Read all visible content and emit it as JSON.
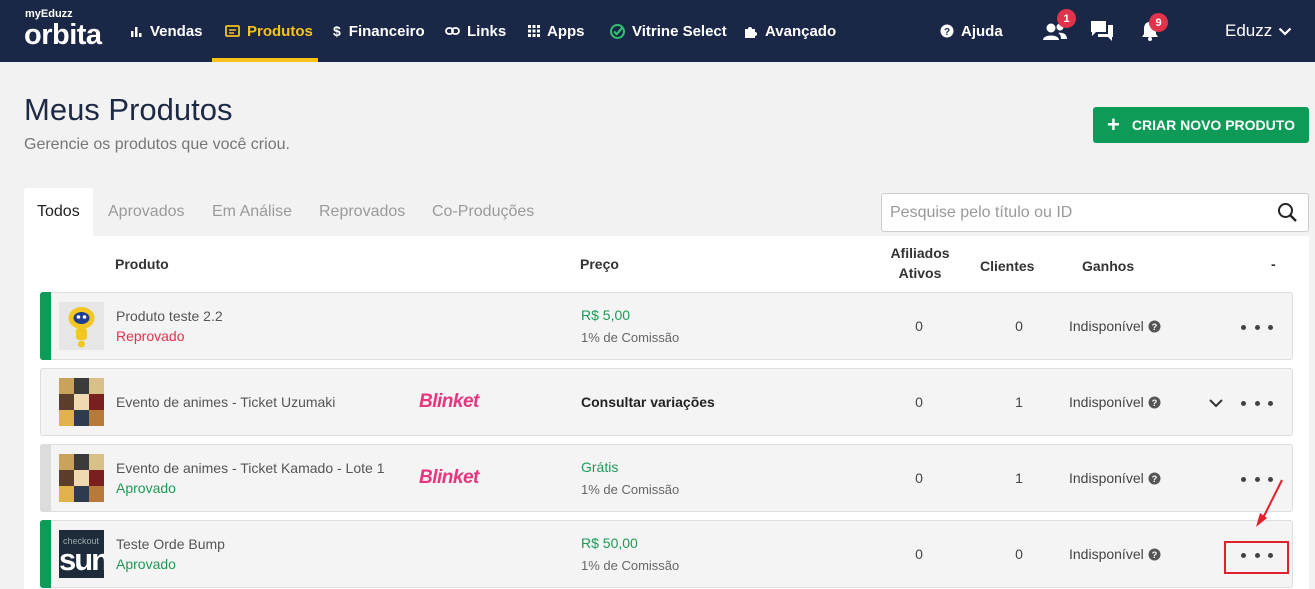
{
  "nav": {
    "logo_small": "myEduzz",
    "logo_big": "orbita",
    "items": [
      {
        "label": "Vendas",
        "icon": "bar-chart-icon"
      },
      {
        "label": "Produtos",
        "icon": "product-card-icon",
        "active": true
      },
      {
        "label": "Financeiro",
        "icon": "dollar-icon"
      },
      {
        "label": "Links",
        "icon": "link-icon"
      },
      {
        "label": "Apps",
        "icon": "grid-icon"
      },
      {
        "label": "Vitrine Select",
        "icon": "check-badge-icon"
      },
      {
        "label": "Avançado",
        "icon": "puzzle-icon"
      }
    ],
    "help_label": "Ajuda",
    "affiliates_badge": "1",
    "notifications_badge": "9",
    "user_label": "Eduzz",
    "active_color": "#f7c21a",
    "bg_color": "#1b2746"
  },
  "header": {
    "title": "Meus Produtos",
    "subtitle": "Gerencie os produtos que você criou.",
    "create_button": "CRIAR NOVO PRODUTO"
  },
  "tabs": [
    "Todos",
    "Aprovados",
    "Em Análise",
    "Reprovados",
    "Co-Produções"
  ],
  "search": {
    "placeholder": "Pesquise pelo título ou ID"
  },
  "table": {
    "headers": {
      "product": "Produto",
      "price": "Preço",
      "affiliates_line1": "Afiliados",
      "affiliates_line2": "Ativos",
      "clients": "Clientes",
      "earnings": "Ganhos",
      "actions": "-"
    },
    "rows": [
      {
        "name": "Produto teste 2.2",
        "status": "Reprovado",
        "status_color": "#e0334c",
        "bar_color": "#0e9b57",
        "price": "R$ 5,00",
        "commission": "1% de Comissão",
        "affiliates": "0",
        "clients": "0",
        "earnings": "Indisponível"
      },
      {
        "name": "Evento de animes - Ticket Uzumaki",
        "status": "",
        "brand": "Blinket",
        "variation": "Consultar variações",
        "affiliates": "0",
        "clients": "1",
        "earnings": "Indisponível"
      },
      {
        "name": "Evento de animes - Ticket Kamado - Lote 1",
        "status": "Aprovado",
        "status_color": "#1d9a55",
        "brand": "Blinket",
        "price": "Grátis",
        "commission": "1% de Comissão",
        "affiliates": "0",
        "clients": "1",
        "earnings": "Indisponível"
      },
      {
        "name": "Teste Orde Bump",
        "status": "Aprovado",
        "status_color": "#1d9a55",
        "bar_color": "#0e9b57",
        "price": "R$ 50,00",
        "commission": "1% de Comissão",
        "affiliates": "0",
        "clients": "0",
        "earnings": "Indisponível",
        "thumb_text_small": "checkout",
        "thumb_text_big": "sun"
      }
    ]
  }
}
